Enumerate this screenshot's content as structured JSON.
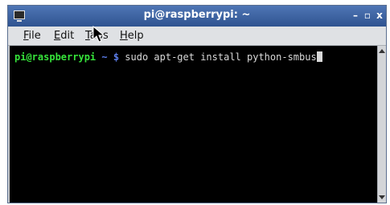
{
  "window": {
    "title": "pi@raspberrypi: ~",
    "controls": {
      "minimize": "–",
      "maximize": "▫",
      "close": "x"
    }
  },
  "menu": {
    "file": "File",
    "edit": "Edit",
    "tabs": "Tabs",
    "help": "Help"
  },
  "terminal": {
    "prompt_user": "pi@raspberrypi",
    "prompt_dir": " ~ $ ",
    "command": "sudo apt-get install python-smbus"
  },
  "colors": {
    "titlebar": "#3f64a3",
    "terminal_bg": "#000000",
    "prompt_user": "#36e33a",
    "prompt_dir": "#5b7ce8"
  }
}
